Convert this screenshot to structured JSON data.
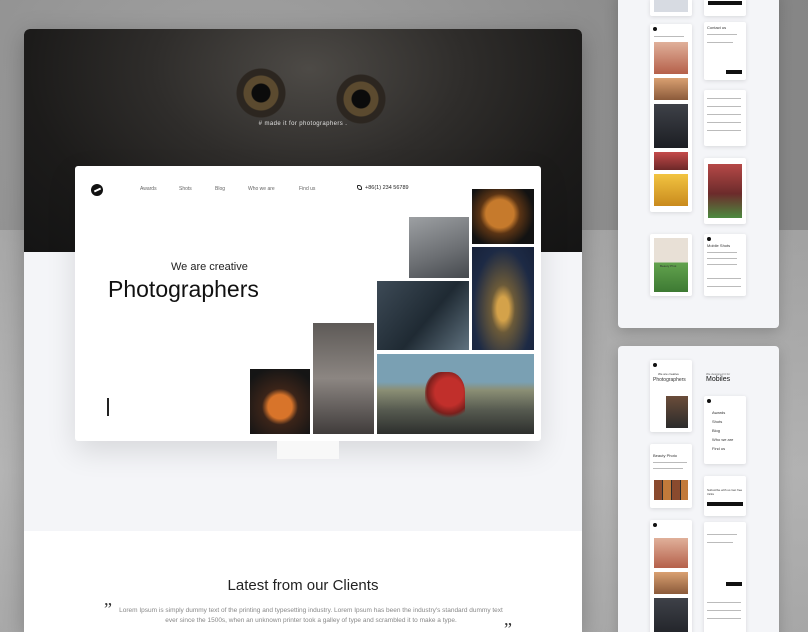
{
  "hero": {
    "tagline": "# made it for photographers ."
  },
  "nav": {
    "items": [
      "Awards",
      "Shots",
      "Blog",
      "Who we are",
      "Find us"
    ],
    "phone": "+86(1) 234 56789"
  },
  "header": {
    "small_heading": "We are creative",
    "big_heading": "Photographers"
  },
  "clients": {
    "title": "Latest from our Clients",
    "text": "Lorem Ipsum is simply dummy text of the printing and typesetting industry. Lorem Ipsum has been the industry's standard dummy text ever since the 1500s, when an unknown printer took a galley of type and scrambled it to make a type.",
    "quote_open": "”",
    "quote_close": "”"
  },
  "mobile_preview": {
    "small_heading": "We are creative",
    "big_heading": "Photographers",
    "mobile_caption": "Mobiles",
    "mobile_caption_small": "We designed it for",
    "menu_items": [
      "Awards",
      "Shots",
      "Blog",
      "Who we are",
      "Find us"
    ],
    "contact_heading": "Contact us",
    "beauty_heading": "Beauty Photo",
    "subscribe_heading": "Subscribe with us Get free tricks",
    "mobile_title": "Mobile Shots",
    "beauty_short": "Beauty Phot"
  },
  "colors": {
    "hero_dark": "#1c1b1a",
    "card_bg": "#f4f5f8",
    "text_dark": "#111111"
  }
}
